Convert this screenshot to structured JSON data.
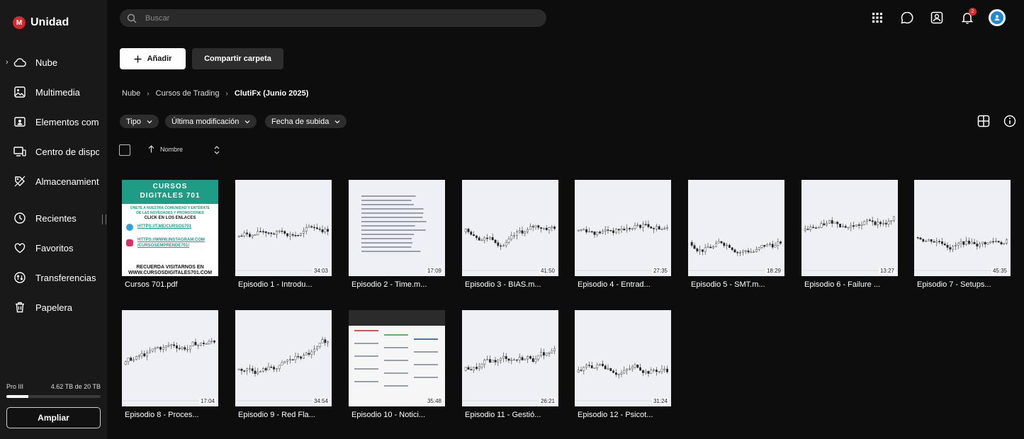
{
  "brand": {
    "logo_letter": "M",
    "name": "Unidad"
  },
  "search": {
    "placeholder": "Buscar"
  },
  "header": {
    "notification_count": "2"
  },
  "sidebar": {
    "items": [
      {
        "label": "Nube",
        "icon": "cloud-icon"
      },
      {
        "label": "Multimedia",
        "icon": "image-icon"
      },
      {
        "label": "Elementos compartidos",
        "icon": "shared-folder-icon"
      },
      {
        "label": "Centro de dispositivos",
        "icon": "devices-icon"
      },
      {
        "label": "Almacenamiento",
        "icon": "storage-tag-icon"
      },
      {
        "label": "Recientes",
        "icon": "clock-icon"
      },
      {
        "label": "Favoritos",
        "icon": "heart-icon"
      },
      {
        "label": "Transferencias",
        "icon": "transfer-icon"
      },
      {
        "label": "Papelera",
        "icon": "trash-icon"
      }
    ],
    "plan": "Pro III",
    "storage_text": "4.62 TB de 20 TB",
    "storage_fraction": 0.23,
    "upgrade_label": "Ampliar"
  },
  "actions": {
    "add_label": "Añadir",
    "share_label": "Compartir carpeta"
  },
  "breadcrumb": [
    "Nube",
    "Cursos de Trading",
    "ClutiFx (Junio 2025)"
  ],
  "filters": [
    "Tipo",
    "Última modificación",
    "Fecha de subida"
  ],
  "sort": {
    "label": "Nombre"
  },
  "pdf": {
    "title1": "CURSOS",
    "title2": "DIGITALES 701",
    "line1": "ÚNETE A NUESTRA COMUNIDAD Y ENTÉRATE",
    "line2": "DE LAS NOVEDADES Y PROMOCIONES",
    "line3": "CLICK EN LOS ENLACES",
    "link1": "HTTPS://T.ME/CURSOS701",
    "link2": "HTTPS://WWW.INSTAGRAM.COM",
    "link3": "/CURSOSEMPRENDE701/",
    "foot1": "RECUERDA VISITARNOS EN",
    "foot2": "WWW.CURSOSDIGITALES701.COM"
  },
  "files": [
    {
      "name": "Cursos 701.pdf",
      "duration": ""
    },
    {
      "name": "Episodio 1 - Introdu...",
      "duration": "34:03"
    },
    {
      "name": "Episodio 2 - Time.m...",
      "duration": "17:09"
    },
    {
      "name": "Episodio 3 - BIAS.m...",
      "duration": "41:50"
    },
    {
      "name": "Episodio 4 - Entrad...",
      "duration": "27:35"
    },
    {
      "name": "Episodio 5 - SMT.m...",
      "duration": "18:29"
    },
    {
      "name": "Episodio 6 - Failure ...",
      "duration": "13:27"
    },
    {
      "name": "Episodio 7 - Setups...",
      "duration": "45:35"
    },
    {
      "name": "Episodio 8 - Proces...",
      "duration": "17:04"
    },
    {
      "name": "Episodio 9 - Red Fla...",
      "duration": "34:54"
    },
    {
      "name": "Episodio 10 - Notici...",
      "duration": "35:48"
    },
    {
      "name": "Episodio 11 - Gestió...",
      "duration": "26:21"
    },
    {
      "name": "Episodio 12 - Psicot...",
      "duration": "31:24"
    }
  ],
  "colors": {
    "accent": "#d9272e",
    "background": "#0d0d0d",
    "sidebar": "#191919",
    "pdf_teal": "#1e9c86"
  }
}
